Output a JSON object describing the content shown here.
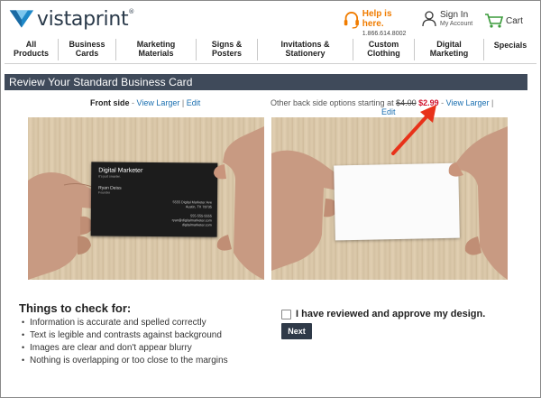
{
  "header": {
    "logo_text": "vistaprint",
    "help_title": "Help is here.",
    "help_phone": "1.866.614.8002",
    "signin_title": "Sign In",
    "signin_sub": "My Account",
    "cart_label": "Cart"
  },
  "nav": {
    "items": [
      {
        "line1": "All",
        "line2": "Products"
      },
      {
        "line1": "Business",
        "line2": "Cards"
      },
      {
        "line1": "Marketing",
        "line2": "Materials"
      },
      {
        "line1": "Signs &",
        "line2": "Posters"
      },
      {
        "line1": "Invitations &",
        "line2": "Stationery"
      },
      {
        "line1": "Custom",
        "line2": "Clothing"
      },
      {
        "line1": "Digital",
        "line2": "Marketing"
      },
      {
        "line1": "Specials",
        "line2": ""
      }
    ]
  },
  "page": {
    "title": "Review Your Standard Business Card"
  },
  "front": {
    "label": "Front side",
    "dash": " - ",
    "view_larger": "View Larger",
    "sep": " | ",
    "edit": "Edit"
  },
  "back": {
    "prefix": "Other back side options starting at ",
    "old_price": "$4.00",
    "new_price": "$2.99",
    "dash": " - ",
    "view_larger": "View Larger",
    "sep": " |",
    "edit": "Edit"
  },
  "card": {
    "name_line": "Digital Marketer",
    "tagline": "It's just smarter.",
    "person": "Ryan Deiss",
    "role": "Founder",
    "address1": "5555 Digital Marketer Ave",
    "address2": "Austin, TX 78735",
    "phone": "555-555-5555",
    "email": "ryan@digitalmarketer.com",
    "web": "digitalmarketer.com"
  },
  "checklist": {
    "title": "Things to check for:",
    "items": [
      "Information is accurate and spelled correctly",
      "Text is legible and contrasts against background",
      "Images are clear and don't appear blurry",
      "Nothing is overlapping or too close to the margins"
    ]
  },
  "approve": {
    "label": "I have reviewed and approve my design.",
    "checked": false,
    "next_label": "Next"
  },
  "colors": {
    "title_bar": "#3f4a5a",
    "link": "#1a6fb0",
    "price": "#d0102c",
    "help": "#f07c00",
    "logo_blue": "#1e88c8",
    "arrow": "#e8321a"
  }
}
